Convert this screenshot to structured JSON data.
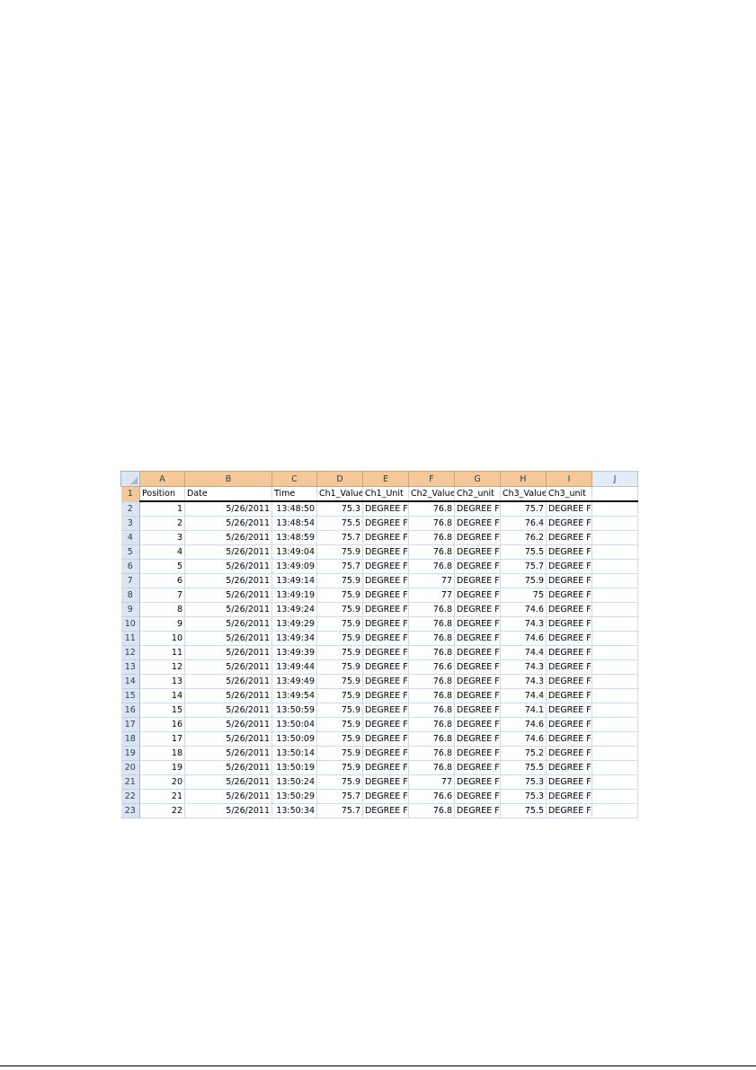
{
  "columns": [
    "A",
    "B",
    "C",
    "D",
    "E",
    "F",
    "G",
    "H",
    "I",
    "J"
  ],
  "header_row": {
    "row_num": "1",
    "cells": [
      "Position",
      "Date",
      "Time",
      "Ch1_Value",
      "Ch1_Unit",
      "Ch2_Value",
      "Ch2_unit",
      "Ch3_Value",
      "Ch3_unit",
      ""
    ]
  },
  "rows": [
    {
      "row_num": "2",
      "position": "1",
      "date": "5/26/2011",
      "time": "13:48:50",
      "ch1_value": "75.3",
      "ch1_unit": "DEGREE F",
      "ch2_value": "76.8",
      "ch2_unit": "DEGREE F",
      "ch3_value": "75.7",
      "ch3_unit": "DEGREE F"
    },
    {
      "row_num": "3",
      "position": "2",
      "date": "5/26/2011",
      "time": "13:48:54",
      "ch1_value": "75.5",
      "ch1_unit": "DEGREE F",
      "ch2_value": "76.8",
      "ch2_unit": "DEGREE F",
      "ch3_value": "76.4",
      "ch3_unit": "DEGREE F"
    },
    {
      "row_num": "4",
      "position": "3",
      "date": "5/26/2011",
      "time": "13:48:59",
      "ch1_value": "75.7",
      "ch1_unit": "DEGREE F",
      "ch2_value": "76.8",
      "ch2_unit": "DEGREE F",
      "ch3_value": "76.2",
      "ch3_unit": "DEGREE F"
    },
    {
      "row_num": "5",
      "position": "4",
      "date": "5/26/2011",
      "time": "13:49:04",
      "ch1_value": "75.9",
      "ch1_unit": "DEGREE F",
      "ch2_value": "76.8",
      "ch2_unit": "DEGREE F",
      "ch3_value": "75.5",
      "ch3_unit": "DEGREE F"
    },
    {
      "row_num": "6",
      "position": "5",
      "date": "5/26/2011",
      "time": "13:49:09",
      "ch1_value": "75.7",
      "ch1_unit": "DEGREE F",
      "ch2_value": "76.8",
      "ch2_unit": "DEGREE F",
      "ch3_value": "75.7",
      "ch3_unit": "DEGREE F"
    },
    {
      "row_num": "7",
      "position": "6",
      "date": "5/26/2011",
      "time": "13:49:14",
      "ch1_value": "75.9",
      "ch1_unit": "DEGREE F",
      "ch2_value": "77",
      "ch2_unit": "DEGREE F",
      "ch3_value": "75.9",
      "ch3_unit": "DEGREE F"
    },
    {
      "row_num": "8",
      "position": "7",
      "date": "5/26/2011",
      "time": "13:49:19",
      "ch1_value": "75.9",
      "ch1_unit": "DEGREE F",
      "ch2_value": "77",
      "ch2_unit": "DEGREE F",
      "ch3_value": "75",
      "ch3_unit": "DEGREE F"
    },
    {
      "row_num": "9",
      "position": "8",
      "date": "5/26/2011",
      "time": "13:49:24",
      "ch1_value": "75.9",
      "ch1_unit": "DEGREE F",
      "ch2_value": "76.8",
      "ch2_unit": "DEGREE F",
      "ch3_value": "74.6",
      "ch3_unit": "DEGREE F"
    },
    {
      "row_num": "10",
      "position": "9",
      "date": "5/26/2011",
      "time": "13:49:29",
      "ch1_value": "75.9",
      "ch1_unit": "DEGREE F",
      "ch2_value": "76.8",
      "ch2_unit": "DEGREE F",
      "ch3_value": "74.3",
      "ch3_unit": "DEGREE F"
    },
    {
      "row_num": "11",
      "position": "10",
      "date": "5/26/2011",
      "time": "13:49:34",
      "ch1_value": "75.9",
      "ch1_unit": "DEGREE F",
      "ch2_value": "76.8",
      "ch2_unit": "DEGREE F",
      "ch3_value": "74.6",
      "ch3_unit": "DEGREE F"
    },
    {
      "row_num": "12",
      "position": "11",
      "date": "5/26/2011",
      "time": "13:49:39",
      "ch1_value": "75.9",
      "ch1_unit": "DEGREE F",
      "ch2_value": "76.8",
      "ch2_unit": "DEGREE F",
      "ch3_value": "74.4",
      "ch3_unit": "DEGREE F"
    },
    {
      "row_num": "13",
      "position": "12",
      "date": "5/26/2011",
      "time": "13:49:44",
      "ch1_value": "75.9",
      "ch1_unit": "DEGREE F",
      "ch2_value": "76.6",
      "ch2_unit": "DEGREE F",
      "ch3_value": "74.3",
      "ch3_unit": "DEGREE F"
    },
    {
      "row_num": "14",
      "position": "13",
      "date": "5/26/2011",
      "time": "13:49:49",
      "ch1_value": "75.9",
      "ch1_unit": "DEGREE F",
      "ch2_value": "76.8",
      "ch2_unit": "DEGREE F",
      "ch3_value": "74.3",
      "ch3_unit": "DEGREE F"
    },
    {
      "row_num": "15",
      "position": "14",
      "date": "5/26/2011",
      "time": "13:49:54",
      "ch1_value": "75.9",
      "ch1_unit": "DEGREE F",
      "ch2_value": "76.8",
      "ch2_unit": "DEGREE F",
      "ch3_value": "74.4",
      "ch3_unit": "DEGREE F"
    },
    {
      "row_num": "16",
      "position": "15",
      "date": "5/26/2011",
      "time": "13:50:59",
      "ch1_value": "75.9",
      "ch1_unit": "DEGREE F",
      "ch2_value": "76.8",
      "ch2_unit": "DEGREE F",
      "ch3_value": "74.1",
      "ch3_unit": "DEGREE F"
    },
    {
      "row_num": "17",
      "position": "16",
      "date": "5/26/2011",
      "time": "13:50:04",
      "ch1_value": "75.9",
      "ch1_unit": "DEGREE F",
      "ch2_value": "76.8",
      "ch2_unit": "DEGREE F",
      "ch3_value": "74.6",
      "ch3_unit": "DEGREE F"
    },
    {
      "row_num": "18",
      "position": "17",
      "date": "5/26/2011",
      "time": "13:50:09",
      "ch1_value": "75.9",
      "ch1_unit": "DEGREE F",
      "ch2_value": "76.8",
      "ch2_unit": "DEGREE F",
      "ch3_value": "74.6",
      "ch3_unit": "DEGREE F"
    },
    {
      "row_num": "19",
      "position": "18",
      "date": "5/26/2011",
      "time": "13:50:14",
      "ch1_value": "75.9",
      "ch1_unit": "DEGREE F",
      "ch2_value": "76.8",
      "ch2_unit": "DEGREE F",
      "ch3_value": "75.2",
      "ch3_unit": "DEGREE F"
    },
    {
      "row_num": "20",
      "position": "19",
      "date": "5/26/2011",
      "time": "13:50:19",
      "ch1_value": "75.9",
      "ch1_unit": "DEGREE F",
      "ch2_value": "76.8",
      "ch2_unit": "DEGREE F",
      "ch3_value": "75.5",
      "ch3_unit": "DEGREE F"
    },
    {
      "row_num": "21",
      "position": "20",
      "date": "5/26/2011",
      "time": "13:50:24",
      "ch1_value": "75.9",
      "ch1_unit": "DEGREE F",
      "ch2_value": "77",
      "ch2_unit": "DEGREE F",
      "ch3_value": "75.3",
      "ch3_unit": "DEGREE F"
    },
    {
      "row_num": "22",
      "position": "21",
      "date": "5/26/2011",
      "time": "13:50:29",
      "ch1_value": "75.7",
      "ch1_unit": "DEGREE F",
      "ch2_value": "76.6",
      "ch2_unit": "DEGREE F",
      "ch3_value": "75.3",
      "ch3_unit": "DEGREE F"
    },
    {
      "row_num": "23",
      "position": "22",
      "date": "5/26/2011",
      "time": "13:50:34",
      "ch1_value": "75.7",
      "ch1_unit": "DEGREE F",
      "ch2_value": "76.8",
      "ch2_unit": "DEGREE F",
      "ch3_value": "75.5",
      "ch3_unit": "DEGREE F"
    }
  ]
}
